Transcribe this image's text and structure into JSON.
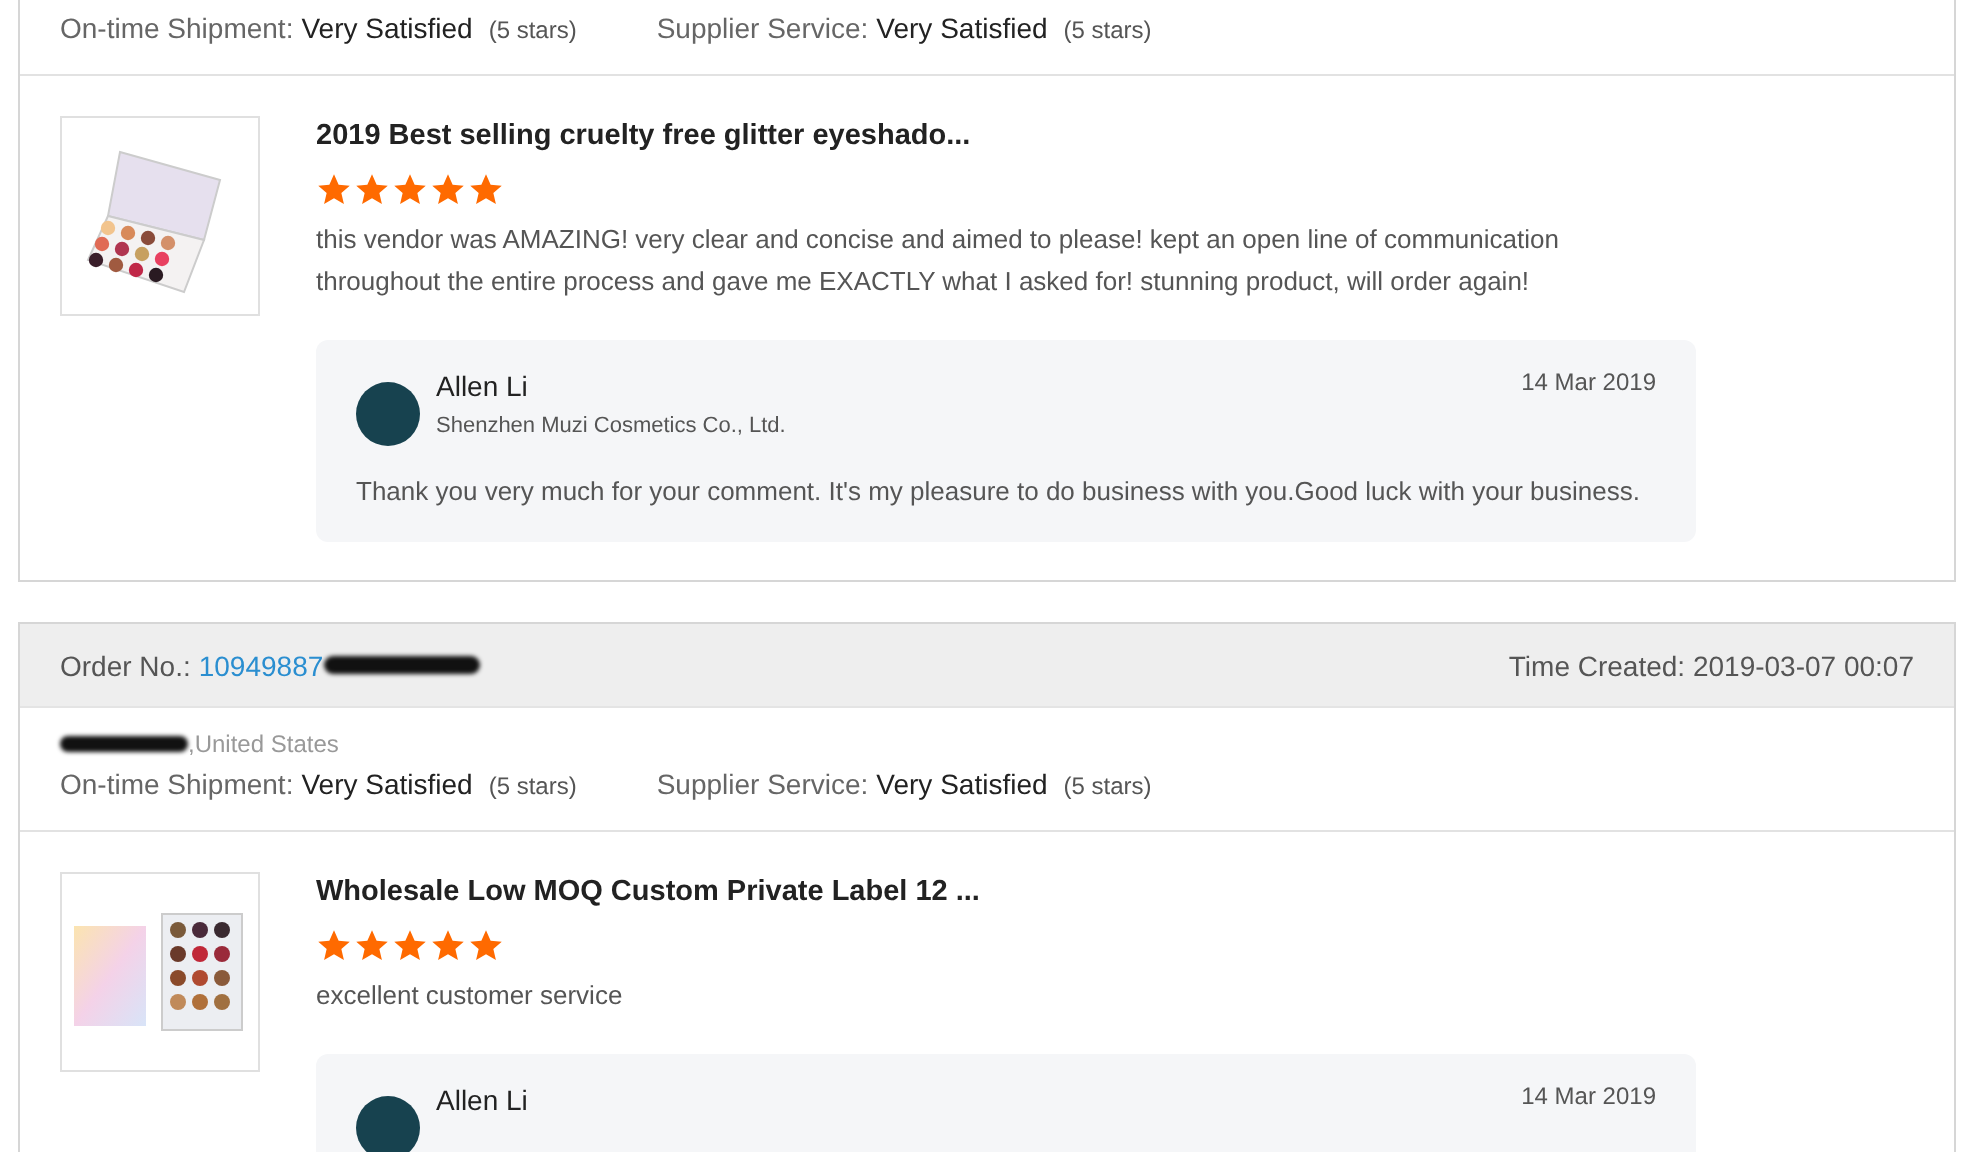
{
  "orders": [
    {
      "ratings": [
        {
          "label": "On-time Shipment:",
          "value": "Very Satisfied",
          "note": "(5 stars)"
        },
        {
          "label": "Supplier Service:",
          "value": "Very Satisfied",
          "note": "(5 stars)"
        }
      ],
      "product": {
        "kind": "palette",
        "title": "2019 Best selling cruelty free glitter eyeshado...",
        "stars": 5,
        "comment": "this vendor was AMAZING! very clear and concise and aimed to please! kept an open line of communication throughout the entire process and gave me EXACTLY what I asked for! stunning product, will order again!"
      },
      "reply": {
        "name": "Allen Li",
        "company": "Shenzhen Muzi Cosmetics Co., Ltd.",
        "date": "14 Mar 2019",
        "message": "Thank you very much for your comment. It's my pleasure to do business with you.Good luck with your business."
      }
    },
    {
      "order": {
        "label": "Order No.:",
        "number": "10949887",
        "time": "Time Created: 2019-03-07 00:07"
      },
      "location": ",United States",
      "ratings": [
        {
          "label": "On-time Shipment:",
          "value": "Very Satisfied",
          "note": "(5 stars)"
        },
        {
          "label": "Supplier Service:",
          "value": "Very Satisfied",
          "note": "(5 stars)"
        }
      ],
      "product": {
        "kind": "box",
        "title": "Wholesale Low MOQ Custom Private Label 12 ...",
        "stars": 5,
        "comment": "excellent customer service"
      },
      "reply": {
        "name": "Allen Li",
        "date": "14 Mar 2019"
      }
    }
  ]
}
